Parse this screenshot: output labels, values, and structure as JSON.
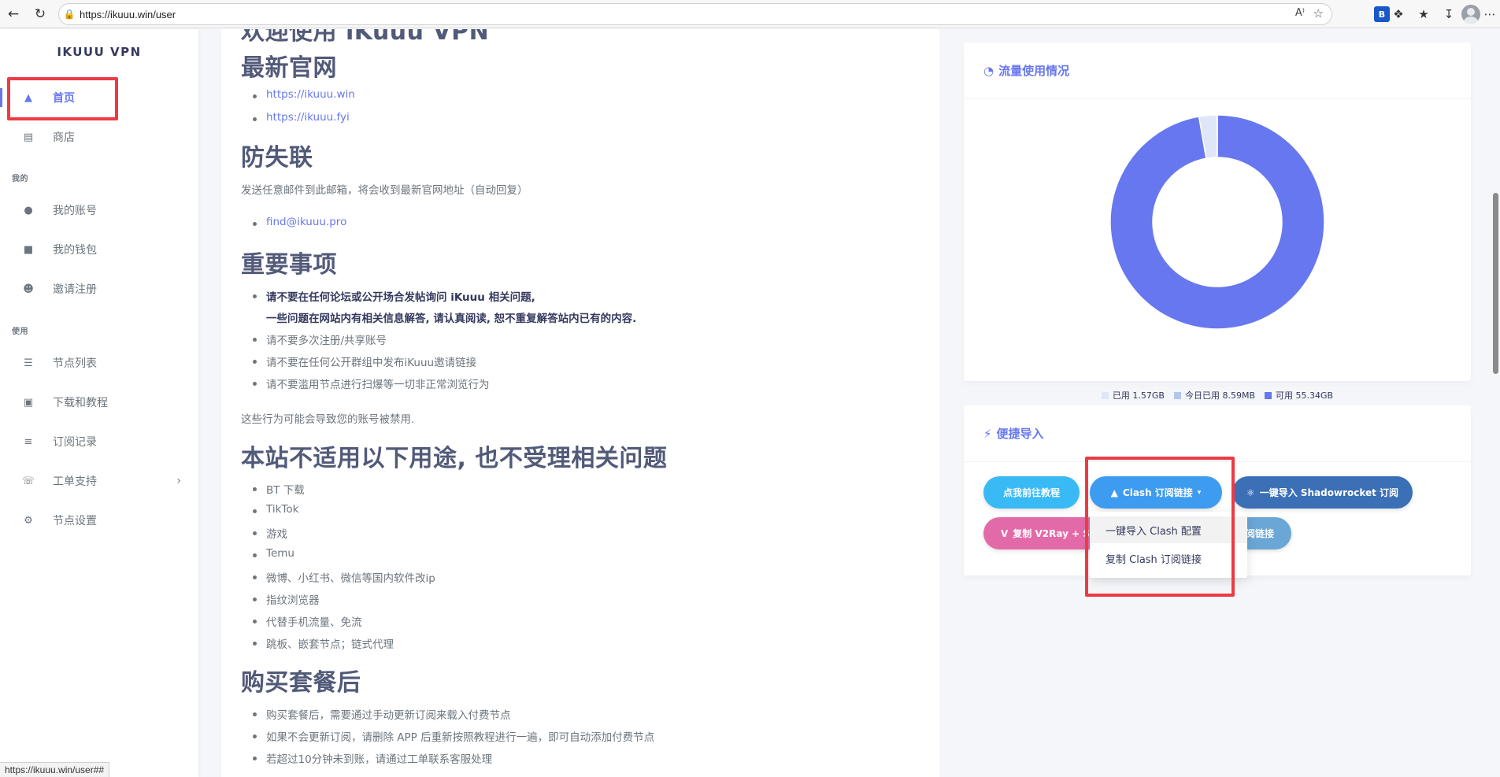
{
  "browser": {
    "url": "https://ikuuu.win/user",
    "status_url": "https://ikuuu.win/user##",
    "read_aloud_label": "A⁾",
    "ext_label": "B"
  },
  "sidebar": {
    "brand": "IKUUU VPN",
    "items": [
      {
        "label": "首页",
        "icon": "fire-icon"
      },
      {
        "label": "商店",
        "icon": "store-icon"
      },
      {
        "label": "我的账号",
        "icon": "user-icon"
      },
      {
        "label": "我的钱包",
        "icon": "wallet-icon"
      },
      {
        "label": "邀请注册",
        "icon": "smile-icon"
      },
      {
        "label": "节点列表",
        "icon": "server-icon"
      },
      {
        "label": "下载和教程",
        "icon": "book-icon"
      },
      {
        "label": "订阅记录",
        "icon": "list-icon"
      },
      {
        "label": "工单支持",
        "icon": "headset-icon"
      },
      {
        "label": "节点设置",
        "icon": "gear-icon"
      }
    ],
    "headers": [
      "我的",
      "使用"
    ]
  },
  "main": {
    "partial_title": "欢迎使用 iKuuu VPN",
    "sections": {
      "official": {
        "title": "最新官网",
        "links": [
          "https://ikuuu.win",
          "https://ikuuu.fyi"
        ]
      },
      "anti_lost": {
        "title": "防失联",
        "desc": "发送任意邮件到此邮箱，将会收到最新官网地址（自动回复）",
        "email": "find@ikuuu.pro"
      },
      "important": {
        "title": "重要事项",
        "bold1": "请不要在任何论坛或公开场合发帖询问 iKuuu 相关问题,",
        "bold2": "一些问题在网站内有相关信息解答, 请认真阅读, 恕不重复解答站内已有的内容.",
        "items": [
          "请不要多次注册/共享账号",
          "请不要在任何公开群组中发布iKuuu邀请链接",
          "请不要滥用节点进行扫爆等一切非正常浏览行为"
        ],
        "warning": "这些行为可能会导致您的账号被禁用."
      },
      "not_for": {
        "title": "本站不适用以下用途, 也不受理相关问题",
        "items": [
          "BT 下载",
          "TikTok",
          "游戏",
          "Temu",
          "微博、小红书、微信等国内软件改ip",
          "指纹浏览器",
          "代替手机流量、免流",
          "跳板、嵌套节点；链式代理"
        ]
      },
      "after_buy": {
        "title": "购买套餐后",
        "items": [
          "购买套餐后，需要通过手动更新订阅来载入付费节点",
          "如果不会更新订阅，请删除 APP 后重新按照教程进行一遍，即可自动添加付费节点",
          "若超过10分钟未到账，请通过工单联系客服处理"
        ]
      }
    }
  },
  "traffic": {
    "title": "流量使用情况",
    "legend": [
      {
        "label": "已用 1.57GB",
        "color": "#dfe6f7"
      },
      {
        "label": "今日已用 8.59MB",
        "color": "#b3c7ee"
      },
      {
        "label": "可用 55.34GB",
        "color": "#6777ef"
      }
    ]
  },
  "import": {
    "title": "便捷导入",
    "buttons": {
      "tutorial": "点我前往教程",
      "clash": "Clash 订阅链接",
      "shadowrocket": "一键导入 Shadowrocket 订阅",
      "v2ray": "复制 V2Ray + S",
      "partial": "阅链接"
    },
    "dropdown": [
      "一键导入 Clash 配置",
      "复制 Clash 订阅链接"
    ]
  },
  "colors": {
    "accent": "#6777ef",
    "tutorial_btn": "#3abaf4",
    "clash_btn": "#3e9cf0",
    "shadowrocket_btn": "#3b6fb6",
    "v2ray_btn": "#e36aa8",
    "highlight_red": "#ec3b45"
  },
  "chart_data": {
    "type": "pie",
    "variant": "donut",
    "categories": [
      "已用 1.57GB",
      "今日已用 8.59MB",
      "可用 55.34GB"
    ],
    "values": [
      1.57,
      0.0084,
      55.34
    ],
    "colors": [
      "#dfe6f7",
      "#b3c7ee",
      "#6777ef"
    ],
    "legend": "bottom"
  }
}
